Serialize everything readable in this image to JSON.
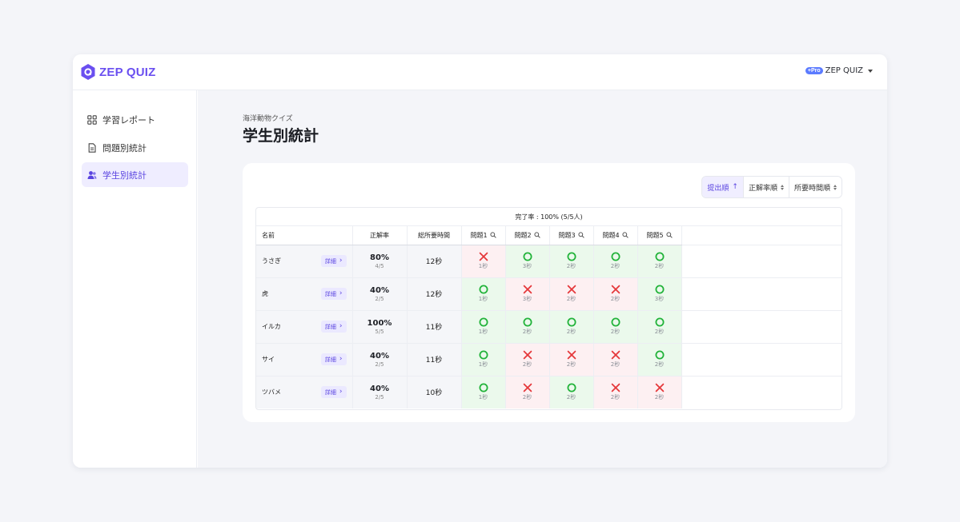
{
  "brand": {
    "logo_text": "ZEP QUIZ",
    "accent": "#6a4ff0"
  },
  "account": {
    "badge": "+Pro",
    "name": "ZEP QUIZ"
  },
  "sidebar": {
    "items": [
      {
        "label": "学習レポート",
        "icon": "grid-icon",
        "active": false
      },
      {
        "label": "問題別統計",
        "icon": "document-icon",
        "active": false
      },
      {
        "label": "学生別統計",
        "icon": "users-icon",
        "active": true
      }
    ]
  },
  "page": {
    "breadcrumb": "海洋動物クイズ",
    "title": "学生別統計"
  },
  "sort": {
    "options": [
      {
        "label": "提出順",
        "active": true
      },
      {
        "label": "正解率順",
        "active": false
      },
      {
        "label": "所要時間順",
        "active": false
      }
    ]
  },
  "table": {
    "completion": "完了率 : 100% (5/5人)",
    "headers": {
      "name": "名前",
      "rate": "正解率",
      "time": "総所要時間"
    },
    "questions": [
      "問題1",
      "問題2",
      "問題3",
      "問題4",
      "問題5"
    ],
    "detail_label": "詳細",
    "rows": [
      {
        "name": "うさぎ",
        "rate": "80%",
        "score": "4/5",
        "time": "12秒",
        "answers": [
          {
            "correct": false,
            "sec": "1秒"
          },
          {
            "correct": true,
            "sec": "3秒"
          },
          {
            "correct": true,
            "sec": "2秒"
          },
          {
            "correct": true,
            "sec": "2秒"
          },
          {
            "correct": true,
            "sec": "2秒"
          }
        ]
      },
      {
        "name": "虎",
        "rate": "40%",
        "score": "2/5",
        "time": "12秒",
        "answers": [
          {
            "correct": true,
            "sec": "1秒"
          },
          {
            "correct": false,
            "sec": "3秒"
          },
          {
            "correct": false,
            "sec": "2秒"
          },
          {
            "correct": false,
            "sec": "2秒"
          },
          {
            "correct": true,
            "sec": "3秒"
          }
        ]
      },
      {
        "name": "イルカ",
        "rate": "100%",
        "score": "5/5",
        "time": "11秒",
        "answers": [
          {
            "correct": true,
            "sec": "1秒"
          },
          {
            "correct": true,
            "sec": "2秒"
          },
          {
            "correct": true,
            "sec": "2秒"
          },
          {
            "correct": true,
            "sec": "2秒"
          },
          {
            "correct": true,
            "sec": "2秒"
          }
        ]
      },
      {
        "name": "サイ",
        "rate": "40%",
        "score": "2/5",
        "time": "11秒",
        "answers": [
          {
            "correct": true,
            "sec": "1秒"
          },
          {
            "correct": false,
            "sec": "2秒"
          },
          {
            "correct": false,
            "sec": "2秒"
          },
          {
            "correct": false,
            "sec": "2秒"
          },
          {
            "correct": true,
            "sec": "2秒"
          }
        ]
      },
      {
        "name": "ツバメ",
        "rate": "40%",
        "score": "2/5",
        "time": "10秒",
        "answers": [
          {
            "correct": true,
            "sec": "1秒"
          },
          {
            "correct": false,
            "sec": "2秒"
          },
          {
            "correct": true,
            "sec": "2秒"
          },
          {
            "correct": false,
            "sec": "2秒"
          },
          {
            "correct": false,
            "sec": "2秒"
          }
        ]
      }
    ]
  },
  "colors": {
    "correct": "#22b33a",
    "wrong": "#e5383b",
    "correct_bg": "#ebf9ec",
    "wrong_bg": "#fdf0f2"
  }
}
